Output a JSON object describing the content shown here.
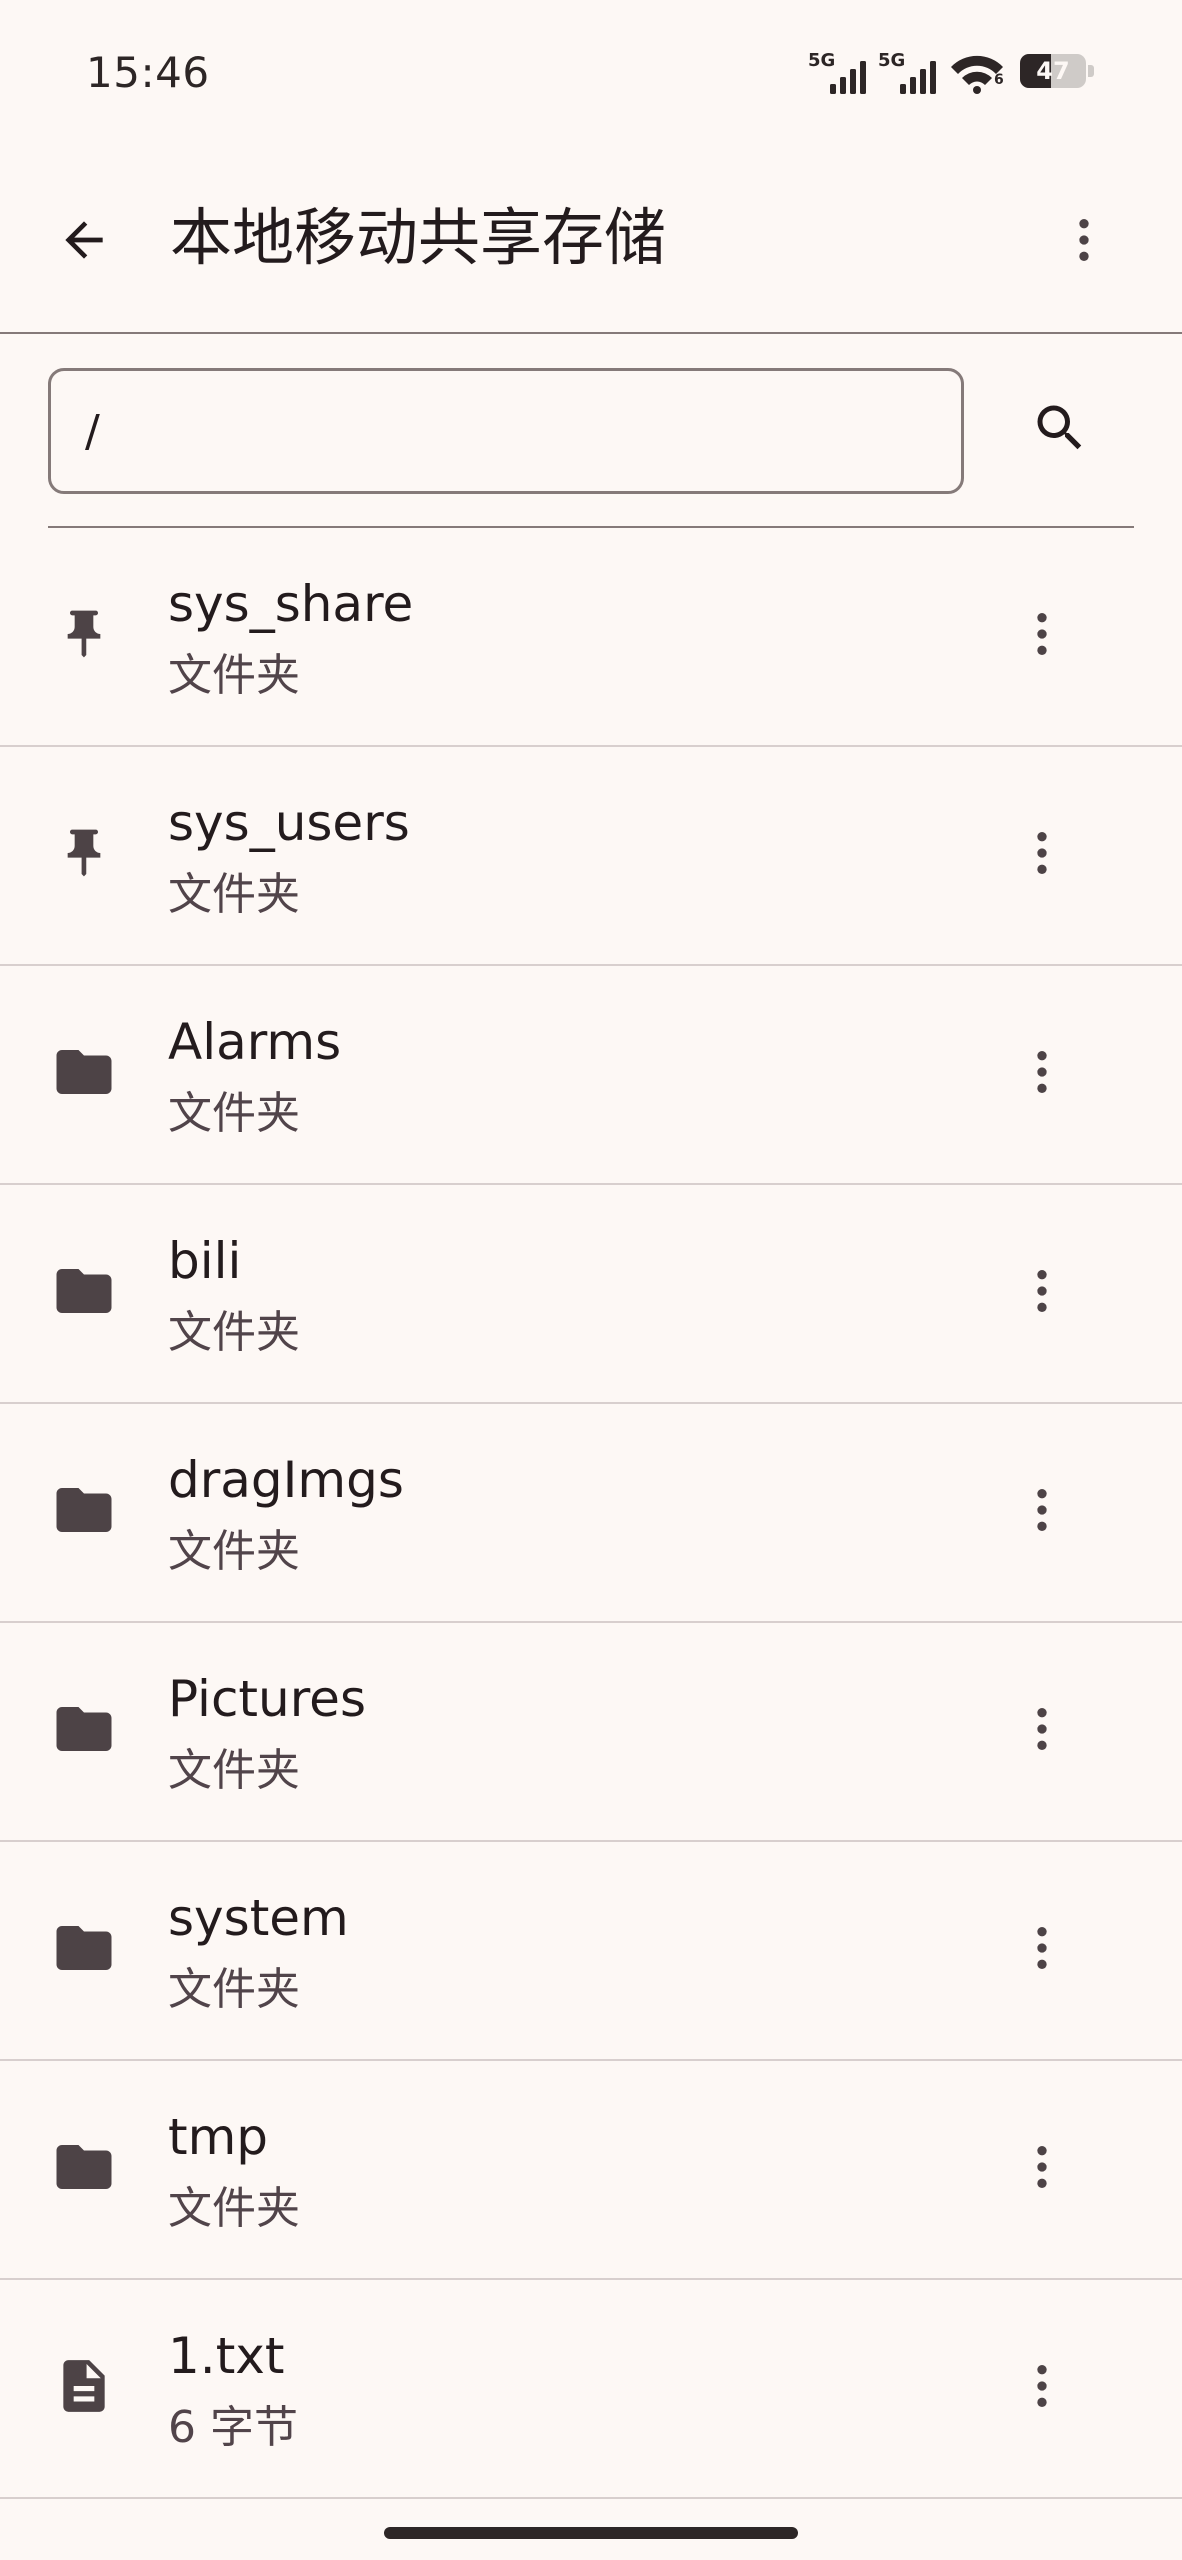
{
  "status_bar": {
    "time": "15:46",
    "signal_1_label": "5G",
    "signal_2_label": "5G",
    "wifi_label": "6",
    "battery_level": "47"
  },
  "app_bar": {
    "title": "本地移动共享存储",
    "back_icon": "arrow-back-icon",
    "menu_icon": "more-vert-icon"
  },
  "search": {
    "path_value": "/",
    "search_icon": "search-icon"
  },
  "files": [
    {
      "name": "sys_share",
      "detail": "文件夹",
      "icon": "pin-icon"
    },
    {
      "name": "sys_users",
      "detail": "文件夹",
      "icon": "pin-icon"
    },
    {
      "name": "Alarms",
      "detail": "文件夹",
      "icon": "folder-icon"
    },
    {
      "name": "bili",
      "detail": "文件夹",
      "icon": "folder-icon"
    },
    {
      "name": "dragImgs",
      "detail": "文件夹",
      "icon": "folder-icon"
    },
    {
      "name": "Pictures",
      "detail": "文件夹",
      "icon": "folder-icon"
    },
    {
      "name": "system",
      "detail": "文件夹",
      "icon": "folder-icon"
    },
    {
      "name": "tmp",
      "detail": "文件夹",
      "icon": "folder-icon"
    },
    {
      "name": "1.txt",
      "detail": "6 字节",
      "icon": "text-file-icon"
    }
  ],
  "colors": {
    "background": "#fdf8f5",
    "icon": "#4d4346",
    "outline": "#857a79",
    "divider": "#d8cfce"
  }
}
